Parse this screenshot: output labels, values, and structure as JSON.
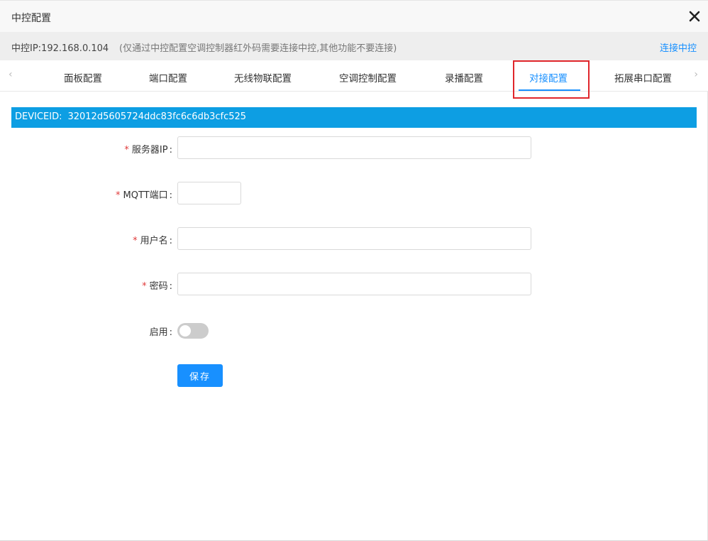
{
  "dialog": {
    "title": "中控配置",
    "close_icon": "close-x-icon"
  },
  "info": {
    "ip_label": "中控IP:192.168.0.104",
    "note": "(仅通过中控配置空调控制器红外码需要连接中控,其他功能不要连接)",
    "connect_link": "连接中控"
  },
  "tabs": {
    "prev_arrow": "‹",
    "next_arrow": "›",
    "items": [
      {
        "label": "面板配置"
      },
      {
        "label": "端口配置"
      },
      {
        "label": "无线物联配置"
      },
      {
        "label": "空调控制配置"
      },
      {
        "label": "录播配置"
      },
      {
        "label": "对接配置"
      },
      {
        "label": "拓展串口配置"
      }
    ],
    "active": "对接配置"
  },
  "device": {
    "label": "DEVICEID:",
    "id": "32012d5605724ddc83fc6c6db3cfc525"
  },
  "form": {
    "required_mark": "*",
    "colon": ":",
    "server_ip": {
      "label": "服务器IP",
      "value": ""
    },
    "mqtt_port": {
      "label": "MQTT端口",
      "value": ""
    },
    "username": {
      "label": "用户名",
      "value": ""
    },
    "password": {
      "label": "密码",
      "value": ""
    },
    "enable": {
      "label": "启用",
      "on": false
    },
    "save_label": "保存"
  },
  "colors": {
    "accent": "#1890ff",
    "banner": "#0d9ee3",
    "highlight": "#e0262b",
    "required": "#e03a3a"
  }
}
